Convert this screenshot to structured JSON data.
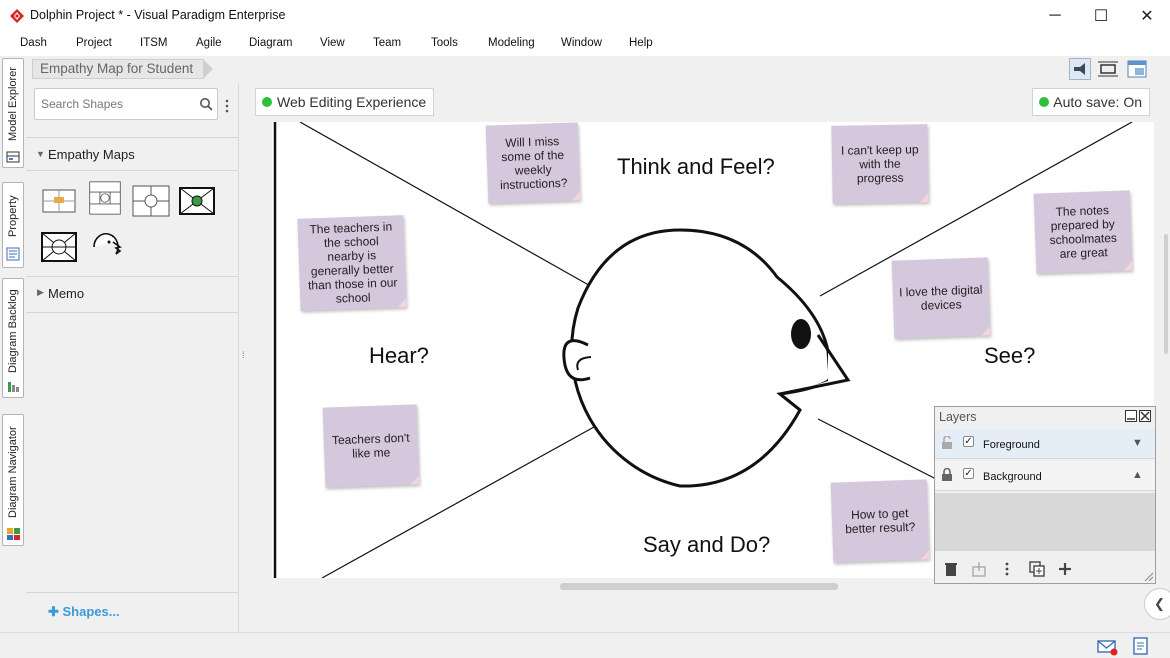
{
  "window": {
    "title": "Dolphin Project * - Visual Paradigm Enterprise",
    "minimize": "─",
    "maximize": "☐",
    "close": "✕"
  },
  "menu": [
    "Dash",
    "Project",
    "ITSM",
    "Agile",
    "Diagram",
    "View",
    "Team",
    "Tools",
    "Modeling",
    "Window",
    "Help"
  ],
  "side_tabs": [
    "Model Explorer",
    "Property",
    "Diagram Backlog",
    "Diagram Navigator"
  ],
  "breadcrumb": "Empathy Map for Student",
  "shapes_panel": {
    "search_placeholder": "Search Shapes",
    "categories": [
      {
        "label": "Empathy Maps",
        "expanded": true
      },
      {
        "label": "Memo",
        "expanded": false
      }
    ],
    "more_shapes": "Shapes..."
  },
  "diagram": {
    "web_editing": "Web Editing Experience",
    "autosave": "Auto save: On",
    "quadrants": {
      "think_feel": "Think and Feel?",
      "hear": "Hear?",
      "see": "See?",
      "say_do": "Say and Do?"
    },
    "stickies": {
      "miss_instructions": "Will I miss some of the weekly instructions?",
      "keep_up": "I can't keep up with the progress",
      "teachers_nearby": "The teachers in the school nearby is generally better than those in our school",
      "notes_schoolmates": "The notes prepared by schoolmates are great",
      "digital_devices": "I love the digital devices",
      "teachers_dont_like": "Teachers don't like me",
      "better_result": "How to get better result?"
    },
    "sticky_color": "#d5c8dd"
  },
  "layers_panel": {
    "title": "Layers",
    "layers": [
      {
        "name": "Foreground",
        "visible": true,
        "locked": false
      },
      {
        "name": "Background",
        "visible": true,
        "locked": true
      }
    ]
  },
  "colors": {
    "accent_logo": "#d9252a",
    "status_dot": "#2fbf3b",
    "link": "#3b9bd6"
  }
}
